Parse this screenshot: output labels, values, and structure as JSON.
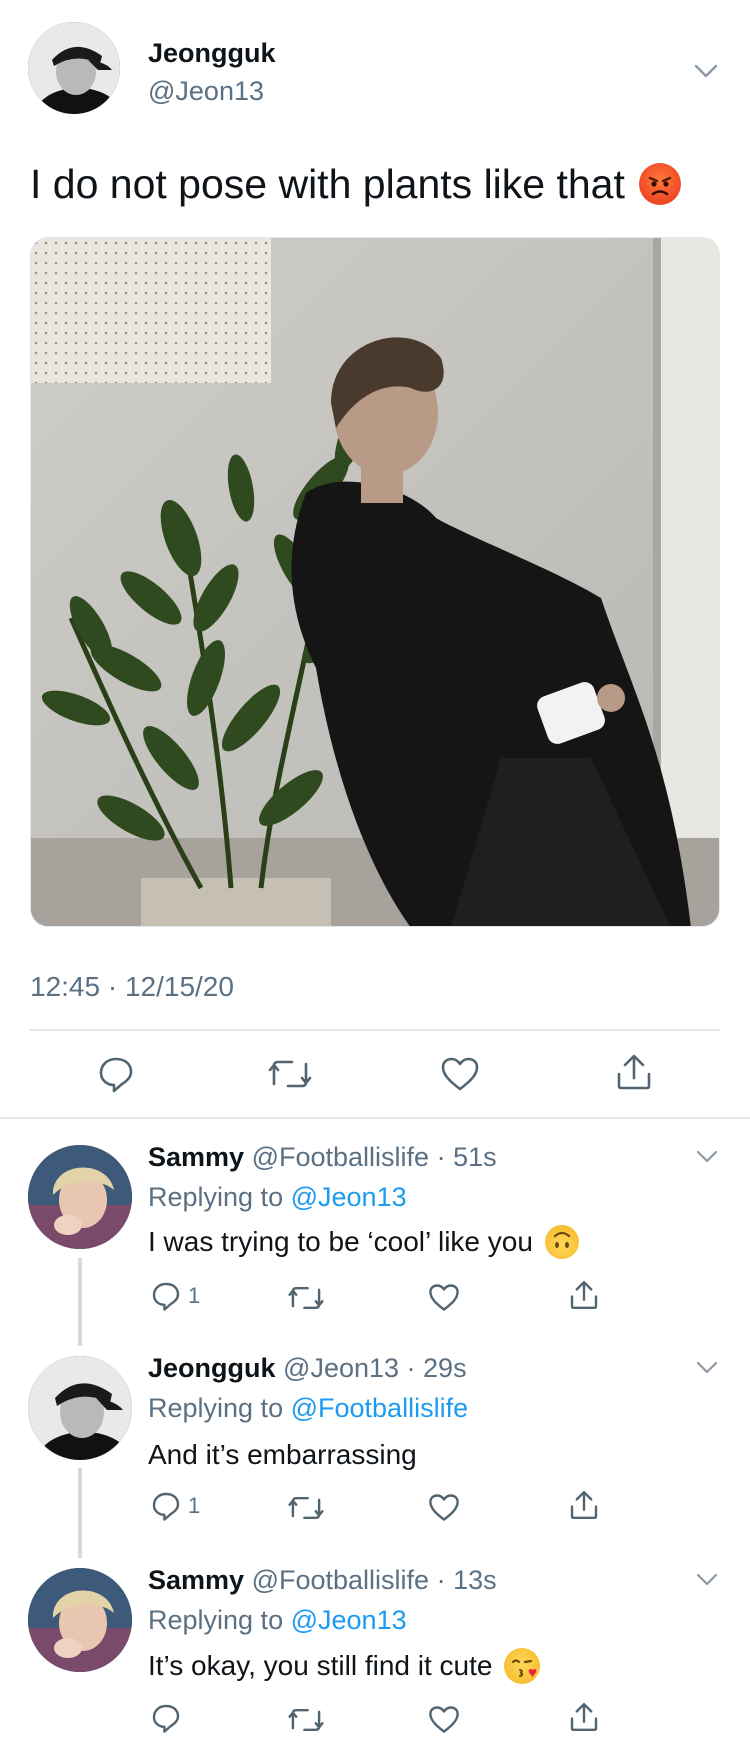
{
  "main_tweet": {
    "author_name": "Jeongguk",
    "author_handle": "@Jeon13",
    "text": "I do not pose with plants like that",
    "timestamp": "12:45 · 12/15/20"
  },
  "replies": [
    {
      "author_name": "Sammy",
      "author_handle": "@Footballislife",
      "age": "· 51s",
      "replying_prefix": "Replying to",
      "replying_to": "@Jeon13",
      "text": "I was trying to be ‘cool’ like you",
      "reply_count": "1"
    },
    {
      "author_name": "Jeongguk",
      "author_handle": "@Jeon13",
      "age": "· 29s",
      "replying_prefix": "Replying to",
      "replying_to": "@Footballislife",
      "text": "And it’s embarrassing",
      "reply_count": "1"
    },
    {
      "author_name": "Sammy",
      "author_handle": "@Footballislife",
      "age": "· 13s",
      "replying_prefix": "Replying to",
      "replying_to": "@Jeon13",
      "text": "It’s okay, you still find it cute",
      "reply_count": ""
    }
  ],
  "icons": {
    "reply": "speech-bubble",
    "retweet": "retweet-arrows",
    "like": "heart-outline",
    "share": "share-arrow-up",
    "more": "chevron-down",
    "angry_emoji": "angry-face",
    "upside_down_emoji": "upside-down-face",
    "kiss_emoji": "face-blowing-kiss"
  },
  "colors": {
    "text": "#0f1419",
    "muted": "#5b7083",
    "link": "#1d9bf0",
    "divider": "#e1e8ed"
  }
}
